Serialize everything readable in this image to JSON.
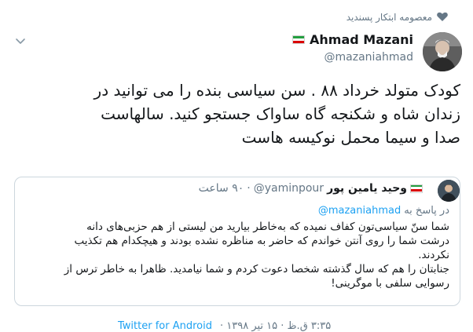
{
  "social_context": {
    "text": "معصومه ابتکار پسندید",
    "icon": "heart-icon"
  },
  "author": {
    "display_name": "Ahmad Mazani",
    "handle": "@mazaniahmad",
    "flag": "iran-flag-icon"
  },
  "tweet": {
    "lines": [
      "کودک متولد خرداد ۸۸ . سن سیاسی بنده را می توانید در",
      "زندان شاه و شکنجه گاه ساواک جستجو کنید. سالهاست",
      "صدا و سیما محمل نوکیسه هاست"
    ]
  },
  "quote": {
    "display_name": "وحید یامین پور",
    "handle": "@yaminpour",
    "time": "۹۰ ساعت",
    "separator": "·",
    "reply_prefix": "در پاسخ به",
    "reply_handle": "@mazaniahmad",
    "body_lines": [
      "شما سنّ سیاسی‌تون کفاف نمیده که به‌خاطر بیارید من لیستی از هم حزبی‌های دانه",
      "درشت شما را روی آنتن خواندم که حاضر به مناظره نشده بودند و هیچکدام هم تکذیب",
      "نکردند.",
      "جنابتان را هم که سال گذشته شخصا دعوت کردم و شما نیامدید. ظاهرا به خاطر ترس از",
      "رسوایی سلفی با موگرینی!"
    ]
  },
  "footer": {
    "time_text": "۳:۳۵ ق.ظ · ۱۵ تیر ۱۳۹۸ ·",
    "source": "Twitter for Android"
  },
  "colors": {
    "text": "#14171a",
    "muted": "#657786",
    "link": "#1da1f2",
    "border": "#ccd6dd"
  }
}
